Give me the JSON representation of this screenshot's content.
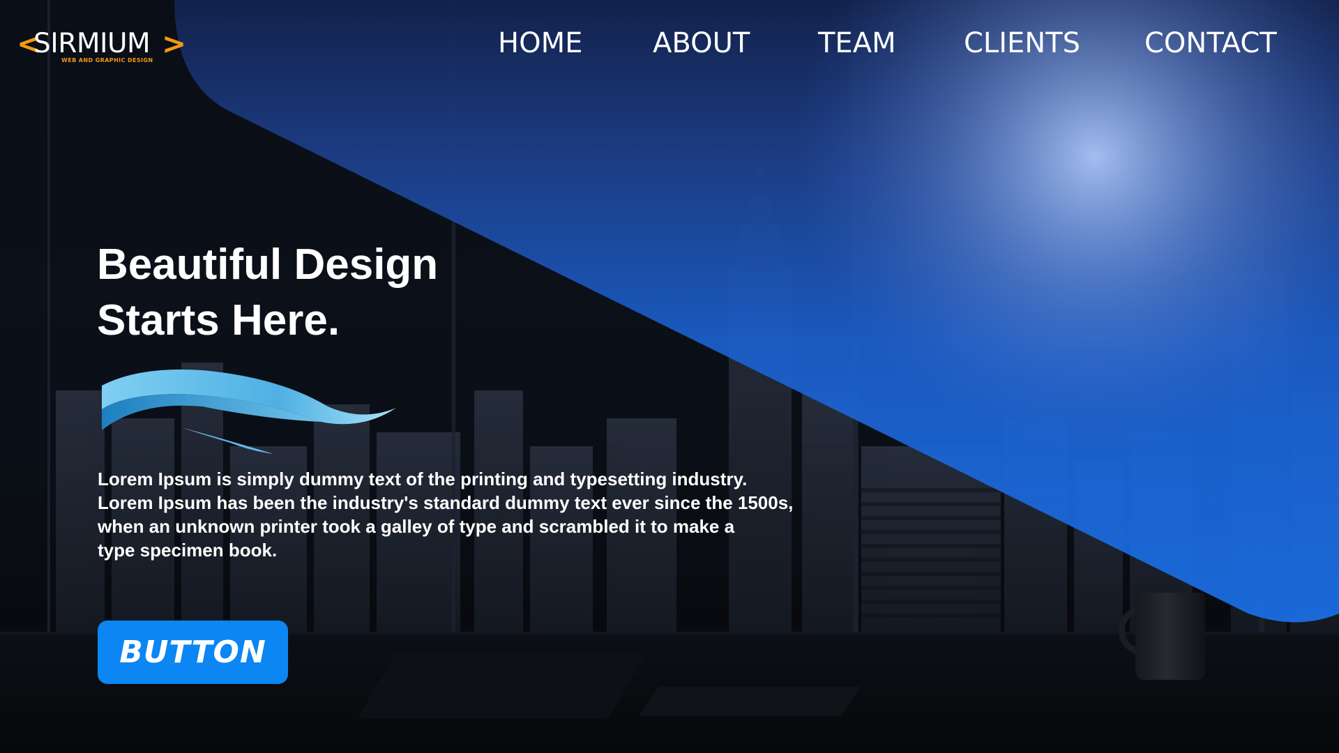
{
  "brand": {
    "name": "SIRMIUM",
    "tagline": "WEB AND GRAPHIC DESIGN",
    "bracket_left": "<",
    "bracket_right": ">",
    "accent_color": "#f09a12"
  },
  "nav": {
    "items": [
      {
        "label": "HOME"
      },
      {
        "label": "ABOUT"
      },
      {
        "label": "TEAM"
      },
      {
        "label": "CLIENTS"
      },
      {
        "label": "CONTACT"
      }
    ]
  },
  "hero": {
    "title_lines": [
      "Beautiful Design",
      "Starts Here."
    ],
    "body_lines": [
      "Lorem Ipsum is simply dummy text of the printing and typesetting industry.",
      "Lorem Ipsum has been the industry's standard dummy text ever since the 1500s,",
      "when an unknown printer took a galley of type and scrambled it to make a",
      "type specimen book."
    ],
    "button_label": "BUTTON"
  },
  "colors": {
    "primary_blue": "#0b86f2",
    "overlay_blue": "#1e6fe0",
    "background_dark": "#05070c"
  },
  "icons": {
    "decoration": "wave-swoosh-icon"
  }
}
